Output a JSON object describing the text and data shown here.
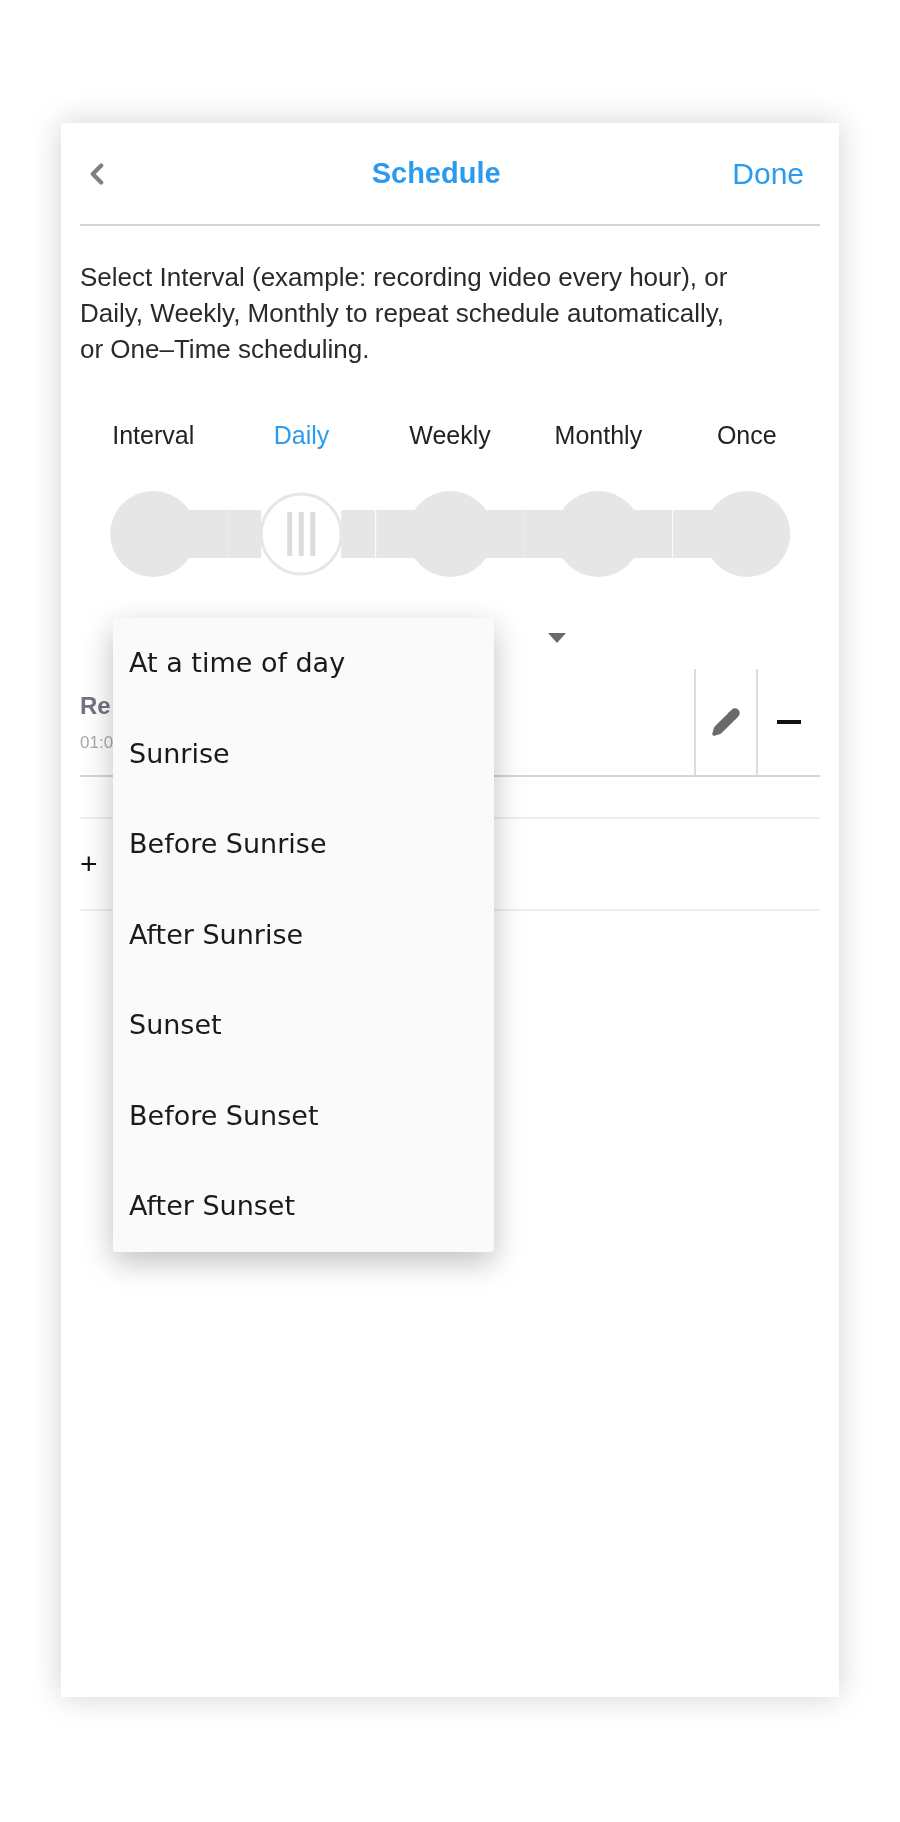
{
  "header": {
    "title": "Schedule",
    "action": "Done"
  },
  "description": "Select Interval (example: recording video every hour), or Daily, Weekly, Monthly to repeat schedule automatically, or One–Time scheduling.",
  "modes": [
    {
      "label": "Interval",
      "selected": false
    },
    {
      "label": "Daily",
      "selected": true
    },
    {
      "label": "Weekly",
      "selected": false
    },
    {
      "label": "Monthly",
      "selected": false
    },
    {
      "label": "Once",
      "selected": false
    }
  ],
  "schedule_row": {
    "title": "Re",
    "time": "01:0"
  },
  "add_row": {
    "label": "+"
  },
  "dropdown": {
    "options": [
      "At a time of day",
      "Sunrise",
      "Before Sunrise",
      "After Sunrise",
      "Sunset",
      "Before Sunset",
      "After Sunset"
    ]
  }
}
